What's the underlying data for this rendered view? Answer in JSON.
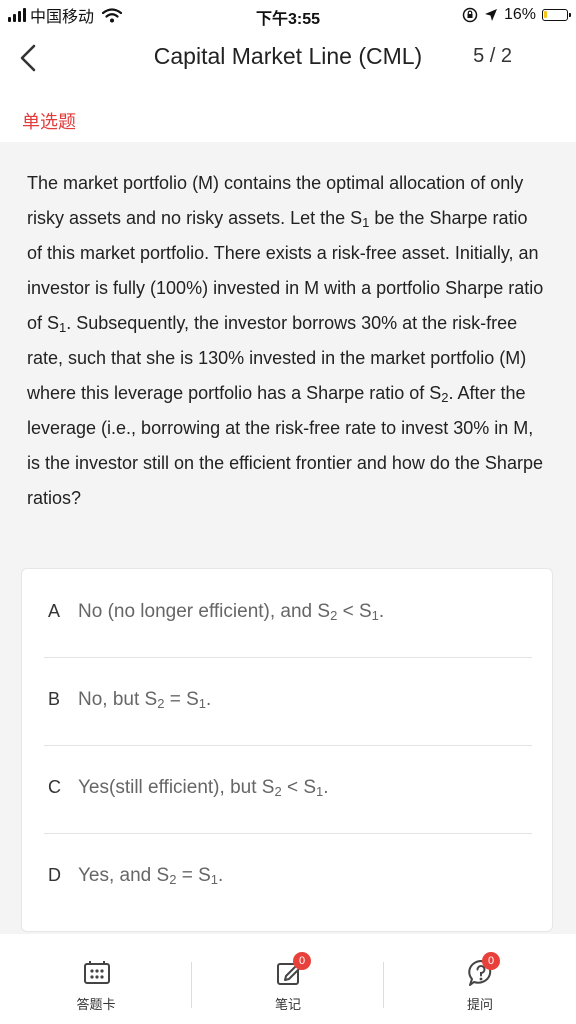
{
  "status_bar": {
    "carrier": "中国移动",
    "time": "下午3:55",
    "battery_percent": "16%",
    "battery_level": 0.16
  },
  "nav": {
    "title": "Capital Market Line (CML)",
    "counter": "5 / 2"
  },
  "question_type": "单选题",
  "question": {
    "p1": "The market portfolio (M) contains the optimal allocation of only risky assets and no risky assets. Let the S",
    "s1": "1",
    "p2": " be the Sharpe ratio of this market portfolio. There exists a risk-free asset. Initially, an investor is fully (100%) invested in M with a portfolio Sharpe ratio of S",
    "p3": ". Subsequently, the investor borrows 30% at the risk-free rate, such that she is 130% invested in the market portfolio (M) where this leverage portfolio has a Sharpe ratio of S",
    "s2": "2",
    "p4": ". After the leverage (i.e., borrowing at the risk-free rate to invest 30% in M, is the investor still on the efficient frontier and how do the Sharpe ratios?"
  },
  "options": [
    {
      "letter": "A",
      "pre": "No (no longer efficient), and S",
      "mid": " < S",
      "post": "."
    },
    {
      "letter": "B",
      "pre": "No, but S",
      "mid": " = S",
      "post": "."
    },
    {
      "letter": "C",
      "pre": "Yes(still efficient), but S",
      "mid": " < S",
      "post": "."
    },
    {
      "letter": "D",
      "pre": "Yes, and S",
      "mid": " = S",
      "post": "."
    }
  ],
  "bottom_tabs": {
    "answer_card": "答题卡",
    "notes": "笔记",
    "notes_badge": "0",
    "ask": "提问",
    "ask_badge": "0"
  }
}
